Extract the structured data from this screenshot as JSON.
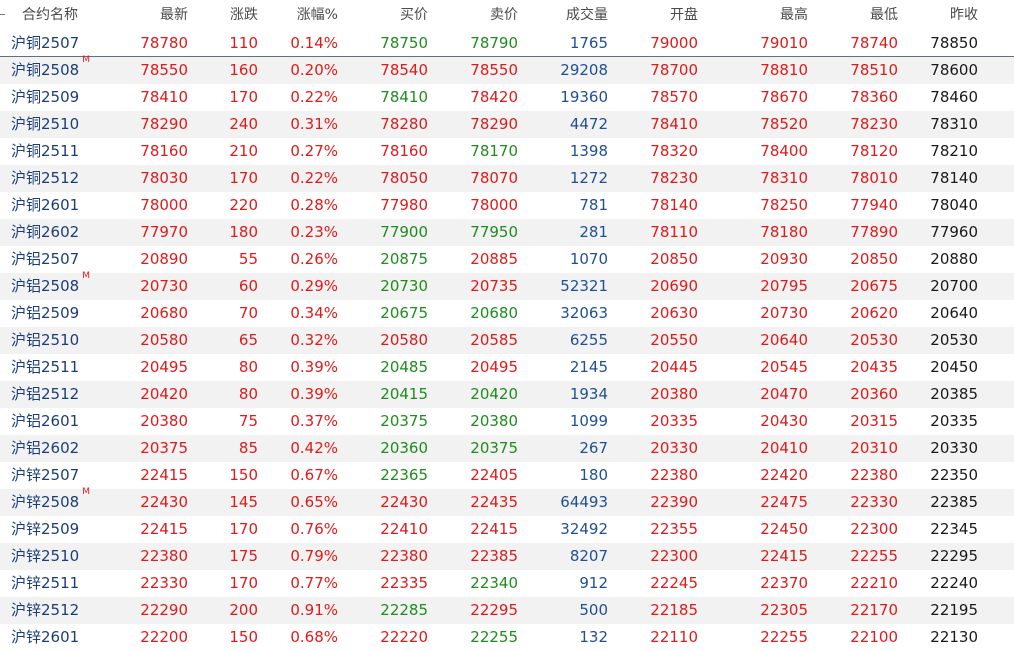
{
  "headers": {
    "name": "合约名称",
    "last": "最新",
    "change": "涨跌",
    "pct": "涨幅%",
    "bid": "买价",
    "ask": "卖价",
    "volume": "成交量",
    "open": "开盘",
    "high": "最高",
    "low": "最低",
    "prev_close": "昨收"
  },
  "colors": {
    "up": "#e01a1a",
    "down": "#1e8c1e",
    "volume": "#1f4f96",
    "name": "#1b3d78",
    "flat": "#1a1a1a"
  },
  "rows": [
    {
      "name": "沪铜2507",
      "badge": "",
      "last": "78780",
      "change": "110",
      "pct": "0.14%",
      "bid": "78750",
      "ask": "78790",
      "volume": "1765",
      "open": "79000",
      "high": "79010",
      "low": "78740",
      "prev_close": "78850",
      "bid_color": "down",
      "ask_color": "down"
    },
    {
      "name": "沪铜2508",
      "badge": "M",
      "last": "78550",
      "change": "160",
      "pct": "0.20%",
      "bid": "78540",
      "ask": "78550",
      "volume": "29208",
      "open": "78700",
      "high": "78810",
      "low": "78510",
      "prev_close": "78600",
      "bid_color": "up",
      "ask_color": "up"
    },
    {
      "name": "沪铜2509",
      "badge": "",
      "last": "78410",
      "change": "170",
      "pct": "0.22%",
      "bid": "78410",
      "ask": "78420",
      "volume": "19360",
      "open": "78570",
      "high": "78670",
      "low": "78360",
      "prev_close": "78460",
      "bid_color": "down",
      "ask_color": "up"
    },
    {
      "name": "沪铜2510",
      "badge": "",
      "last": "78290",
      "change": "240",
      "pct": "0.31%",
      "bid": "78280",
      "ask": "78290",
      "volume": "4472",
      "open": "78410",
      "high": "78520",
      "low": "78230",
      "prev_close": "78310",
      "bid_color": "up",
      "ask_color": "up"
    },
    {
      "name": "沪铜2511",
      "badge": "",
      "last": "78160",
      "change": "210",
      "pct": "0.27%",
      "bid": "78160",
      "ask": "78170",
      "volume": "1398",
      "open": "78320",
      "high": "78400",
      "low": "78120",
      "prev_close": "78210",
      "bid_color": "up",
      "ask_color": "down"
    },
    {
      "name": "沪铜2512",
      "badge": "",
      "last": "78030",
      "change": "170",
      "pct": "0.22%",
      "bid": "78050",
      "ask": "78070",
      "volume": "1272",
      "open": "78230",
      "high": "78310",
      "low": "78010",
      "prev_close": "78140",
      "bid_color": "up",
      "ask_color": "up"
    },
    {
      "name": "沪铜2601",
      "badge": "",
      "last": "78000",
      "change": "220",
      "pct": "0.28%",
      "bid": "77980",
      "ask": "78000",
      "volume": "781",
      "open": "78140",
      "high": "78250",
      "low": "77940",
      "prev_close": "78040",
      "bid_color": "up",
      "ask_color": "up"
    },
    {
      "name": "沪铜2602",
      "badge": "",
      "last": "77970",
      "change": "180",
      "pct": "0.23%",
      "bid": "77900",
      "ask": "77950",
      "volume": "281",
      "open": "78110",
      "high": "78180",
      "low": "77890",
      "prev_close": "77960",
      "bid_color": "down",
      "ask_color": "down"
    },
    {
      "name": "沪铝2507",
      "badge": "",
      "last": "20890",
      "change": "55",
      "pct": "0.26%",
      "bid": "20875",
      "ask": "20885",
      "volume": "1070",
      "open": "20850",
      "high": "20930",
      "low": "20850",
      "prev_close": "20880",
      "bid_color": "down",
      "ask_color": "up"
    },
    {
      "name": "沪铝2508",
      "badge": "M",
      "last": "20730",
      "change": "60",
      "pct": "0.29%",
      "bid": "20730",
      "ask": "20735",
      "volume": "52321",
      "open": "20690",
      "high": "20795",
      "low": "20675",
      "prev_close": "20700",
      "bid_color": "down",
      "ask_color": "up"
    },
    {
      "name": "沪铝2509",
      "badge": "",
      "last": "20680",
      "change": "70",
      "pct": "0.34%",
      "bid": "20675",
      "ask": "20680",
      "volume": "32063",
      "open": "20630",
      "high": "20730",
      "low": "20620",
      "prev_close": "20640",
      "bid_color": "down",
      "ask_color": "down"
    },
    {
      "name": "沪铝2510",
      "badge": "",
      "last": "20580",
      "change": "65",
      "pct": "0.32%",
      "bid": "20580",
      "ask": "20585",
      "volume": "6255",
      "open": "20550",
      "high": "20640",
      "low": "20530",
      "prev_close": "20530",
      "bid_color": "up",
      "ask_color": "up"
    },
    {
      "name": "沪铝2511",
      "badge": "",
      "last": "20495",
      "change": "80",
      "pct": "0.39%",
      "bid": "20485",
      "ask": "20495",
      "volume": "2145",
      "open": "20445",
      "high": "20545",
      "low": "20435",
      "prev_close": "20450",
      "bid_color": "down",
      "ask_color": "up"
    },
    {
      "name": "沪铝2512",
      "badge": "",
      "last": "20420",
      "change": "80",
      "pct": "0.39%",
      "bid": "20415",
      "ask": "20420",
      "volume": "1934",
      "open": "20380",
      "high": "20470",
      "low": "20360",
      "prev_close": "20385",
      "bid_color": "down",
      "ask_color": "down"
    },
    {
      "name": "沪铝2601",
      "badge": "",
      "last": "20380",
      "change": "75",
      "pct": "0.37%",
      "bid": "20375",
      "ask": "20380",
      "volume": "1099",
      "open": "20335",
      "high": "20430",
      "low": "20315",
      "prev_close": "20335",
      "bid_color": "down",
      "ask_color": "down"
    },
    {
      "name": "沪铝2602",
      "badge": "",
      "last": "20375",
      "change": "85",
      "pct": "0.42%",
      "bid": "20360",
      "ask": "20375",
      "volume": "267",
      "open": "20330",
      "high": "20410",
      "low": "20310",
      "prev_close": "20330",
      "bid_color": "down",
      "ask_color": "down"
    },
    {
      "name": "沪锌2507",
      "badge": "",
      "last": "22415",
      "change": "150",
      "pct": "0.67%",
      "bid": "22365",
      "ask": "22405",
      "volume": "180",
      "open": "22380",
      "high": "22420",
      "low": "22380",
      "prev_close": "22350",
      "bid_color": "down",
      "ask_color": "up"
    },
    {
      "name": "沪锌2508",
      "badge": "M",
      "last": "22430",
      "change": "145",
      "pct": "0.65%",
      "bid": "22430",
      "ask": "22435",
      "volume": "64493",
      "open": "22390",
      "high": "22475",
      "low": "22330",
      "prev_close": "22385",
      "bid_color": "up",
      "ask_color": "up"
    },
    {
      "name": "沪锌2509",
      "badge": "",
      "last": "22415",
      "change": "170",
      "pct": "0.76%",
      "bid": "22410",
      "ask": "22415",
      "volume": "32492",
      "open": "22355",
      "high": "22450",
      "low": "22300",
      "prev_close": "22345",
      "bid_color": "up",
      "ask_color": "up"
    },
    {
      "name": "沪锌2510",
      "badge": "",
      "last": "22380",
      "change": "175",
      "pct": "0.79%",
      "bid": "22380",
      "ask": "22385",
      "volume": "8207",
      "open": "22300",
      "high": "22415",
      "low": "22255",
      "prev_close": "22295",
      "bid_color": "up",
      "ask_color": "up"
    },
    {
      "name": "沪锌2511",
      "badge": "",
      "last": "22330",
      "change": "170",
      "pct": "0.77%",
      "bid": "22335",
      "ask": "22340",
      "volume": "912",
      "open": "22245",
      "high": "22370",
      "low": "22210",
      "prev_close": "22240",
      "bid_color": "up",
      "ask_color": "down"
    },
    {
      "name": "沪锌2512",
      "badge": "",
      "last": "22290",
      "change": "200",
      "pct": "0.91%",
      "bid": "22285",
      "ask": "22295",
      "volume": "500",
      "open": "22185",
      "high": "22305",
      "low": "22170",
      "prev_close": "22195",
      "bid_color": "down",
      "ask_color": "up"
    },
    {
      "name": "沪锌2601",
      "badge": "",
      "last": "22200",
      "change": "150",
      "pct": "0.68%",
      "bid": "22220",
      "ask": "22255",
      "volume": "132",
      "open": "22110",
      "high": "22255",
      "low": "22100",
      "prev_close": "22130",
      "bid_color": "up",
      "ask_color": "down"
    }
  ]
}
